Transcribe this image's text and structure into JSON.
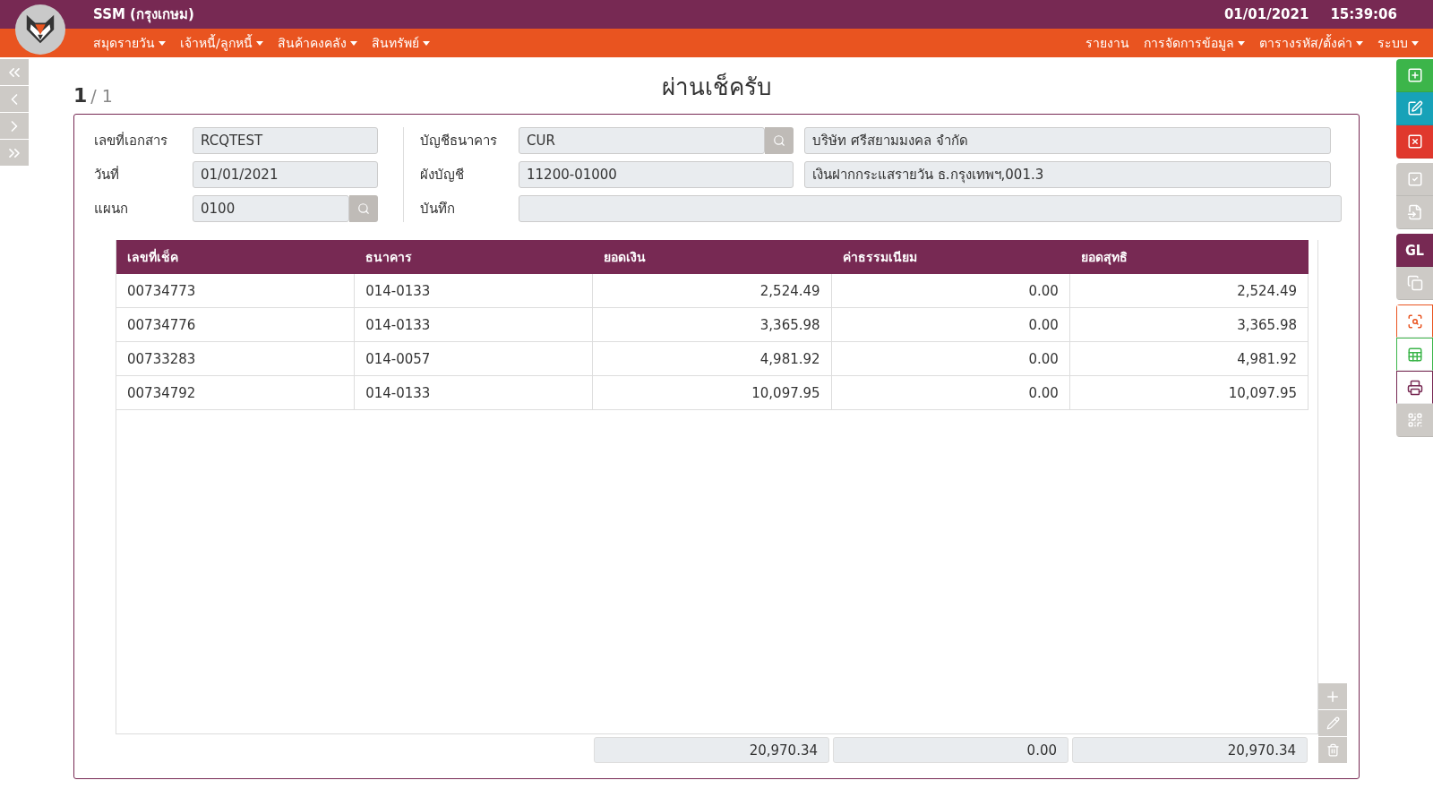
{
  "header": {
    "app_title": "SSM (กรุงเกษม)",
    "date": "01/01/2021",
    "time": "15:39:06"
  },
  "menu_left": [
    {
      "label": "สมุดรายวัน",
      "dropdown": true
    },
    {
      "label": "เจ้าหนี้/ลูกหนี้",
      "dropdown": true
    },
    {
      "label": "สินค้าคงคลัง",
      "dropdown": true
    },
    {
      "label": "สินทรัพย์",
      "dropdown": true
    }
  ],
  "menu_right": [
    {
      "label": "รายงาน",
      "dropdown": false
    },
    {
      "label": "การจัดการข้อมูล",
      "dropdown": true
    },
    {
      "label": "ตารางรหัส/ตั้งค่า",
      "dropdown": true
    },
    {
      "label": "ระบบ",
      "dropdown": true
    }
  ],
  "pager": {
    "current": "1",
    "total": "/ 1"
  },
  "title": "ผ่านเช็ครับ",
  "form_left": [
    {
      "label": "เลขที่เอกสาร",
      "kind": "text",
      "value": "RCQTEST"
    },
    {
      "label": "วันที่",
      "kind": "text",
      "value": "01/01/2021"
    },
    {
      "label": "แผนก",
      "kind": "lookup",
      "value": "0100"
    }
  ],
  "form_right": [
    {
      "label": "บัญชีธนาคาร",
      "kind": "lookup",
      "value": "CUR",
      "description": "บริษัท ศรีสยามมงคล จำกัด"
    },
    {
      "label": "ผังบัญชี",
      "kind": "text",
      "value": "11200-01000",
      "description": "เงินฝากกระแสรายวัน ธ.กรุงเทพฯ,001.3"
    },
    {
      "label": "บันทึก",
      "kind": "textarea"
    }
  ],
  "table": {
    "columns": [
      {
        "label": "เลขที่เช็ค",
        "numeric": false
      },
      {
        "label": "ธนาคาร",
        "numeric": false
      },
      {
        "label": "ยอดเงิน",
        "numeric": true
      },
      {
        "label": "ค่าธรรมเนียม",
        "numeric": true
      },
      {
        "label": "ยอดสุทธิ",
        "numeric": true
      }
    ],
    "rows": [
      [
        "00734773",
        "014-0133",
        "2,524.49",
        "0.00",
        "2,524.49"
      ],
      [
        "00734776",
        "014-0133",
        "3,365.98",
        "0.00",
        "3,365.98"
      ],
      [
        "00733283",
        "014-0057",
        "4,981.92",
        "0.00",
        "4,981.92"
      ],
      [
        "00734792",
        "014-0133",
        "10,097.95",
        "0.00",
        "10,097.95"
      ]
    ],
    "totals": [
      "20,970.34",
      "0.00",
      "20,970.34"
    ]
  },
  "toolbar": [
    {
      "tools": [
        {
          "kind": "add",
          "disabled": false,
          "outline": false,
          "color": "#3cb54a"
        },
        {
          "kind": "edit",
          "disabled": false,
          "outline": false,
          "color": "#17a2b8"
        },
        {
          "kind": "cancel",
          "disabled": false,
          "outline": false,
          "color": "#e0382d"
        }
      ]
    },
    {
      "tools": [
        {
          "kind": "approve",
          "disabled": true
        },
        {
          "kind": "revert",
          "disabled": true
        }
      ]
    },
    {
      "tools": [
        {
          "kind": "gl",
          "label": "GL",
          "disabled": false,
          "outline": false,
          "color": "#772953"
        },
        {
          "kind": "copy",
          "disabled": true
        }
      ]
    },
    {
      "tools": [
        {
          "kind": "preview",
          "disabled": false,
          "outline": true,
          "color": "#e95420"
        },
        {
          "kind": "sheet",
          "disabled": false,
          "outline": true,
          "color": "#3cb54a"
        },
        {
          "kind": "print",
          "disabled": false,
          "outline": true,
          "color": "#772953"
        },
        {
          "kind": "scan",
          "disabled": true
        }
      ]
    }
  ]
}
